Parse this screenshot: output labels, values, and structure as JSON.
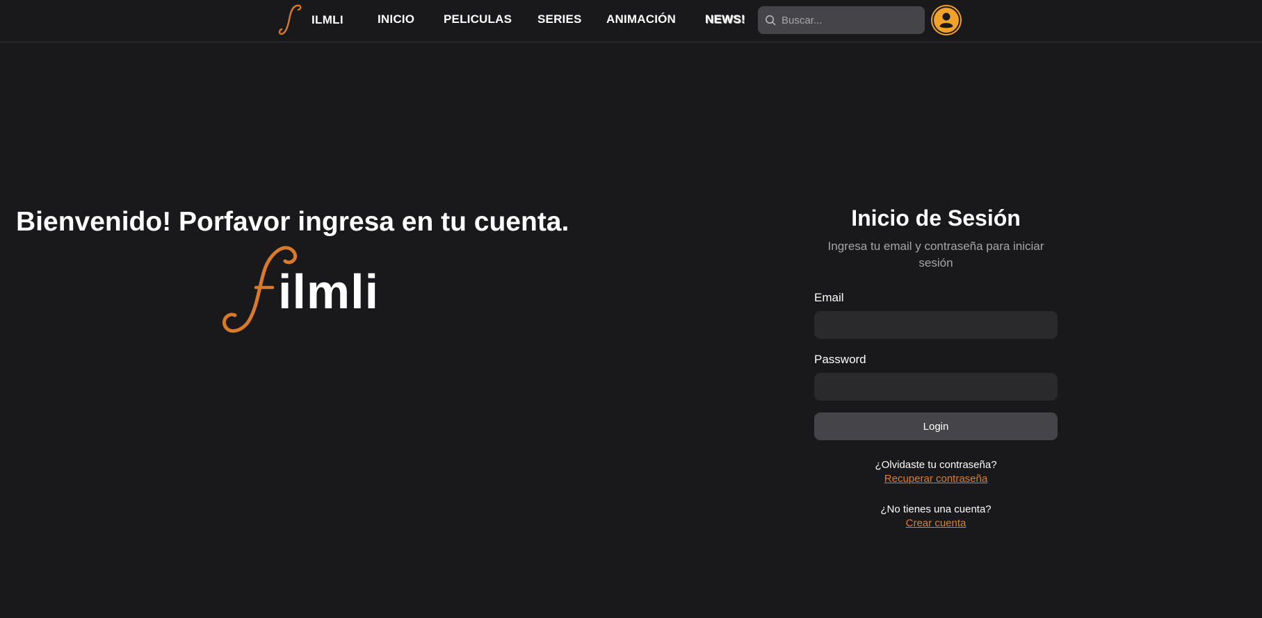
{
  "brand": {
    "name": "ILMLI",
    "large_name": "ilmli",
    "accent_color": "#d97a2b",
    "avatar_color": "#f0a22a"
  },
  "nav": {
    "items": [
      {
        "label": "INICIO"
      },
      {
        "label": "PELICULAS"
      },
      {
        "label": "SERIES"
      },
      {
        "label": "ANIMACIÓN"
      },
      {
        "label": "NEWS!"
      }
    ],
    "search": {
      "placeholder": "Buscar...",
      "icon": "search-icon"
    },
    "avatar_icon": "user-icon"
  },
  "hero": {
    "welcome": "Bienvenido! Porfavor ingresa en tu cuenta."
  },
  "login": {
    "title": "Inicio de Sesión",
    "subtitle": "Ingresa tu email y contraseña para iniciar sesión",
    "email_label": "Email",
    "email_value": "",
    "password_label": "Password",
    "password_value": "",
    "button_label": "Login",
    "forgot_question": "¿Olvidaste tu contraseña?",
    "forgot_link": "Recuperar contraseña",
    "signup_question": "¿No tienes una cuenta?",
    "signup_link": "Crear cuenta"
  }
}
